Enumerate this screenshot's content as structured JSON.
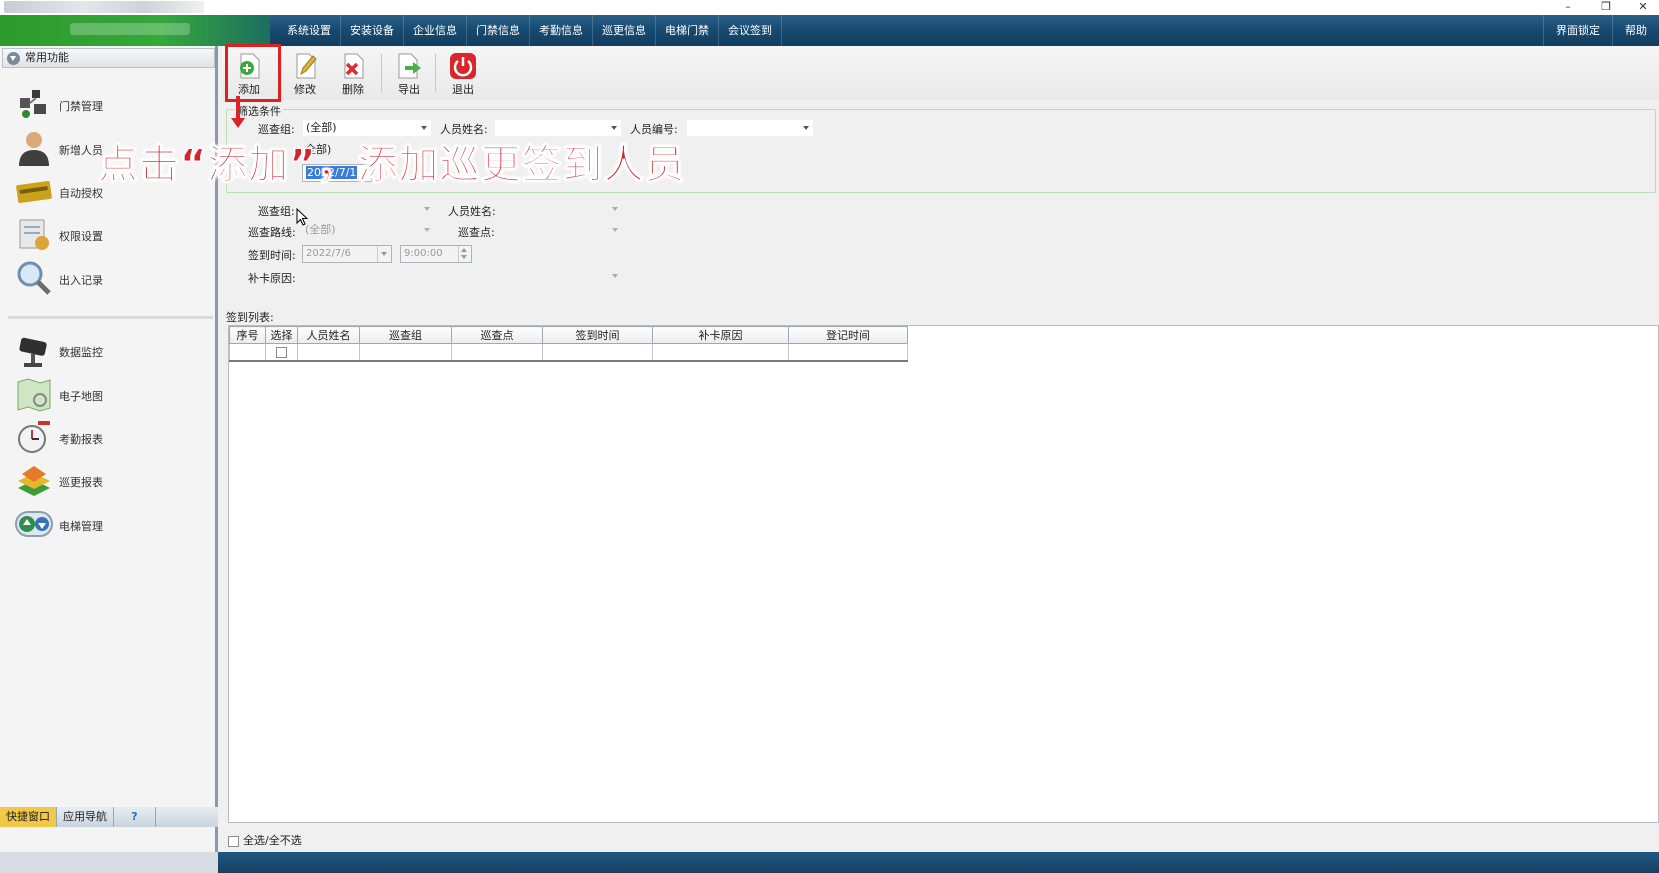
{
  "menu": {
    "items": [
      "系统设置",
      "安装设备",
      "企业信息",
      "门禁信息",
      "考勤信息",
      "巡更信息",
      "电梯门禁",
      "会议签到"
    ],
    "right_items": [
      "界面锁定",
      "帮助"
    ]
  },
  "sidebar": {
    "header": "常用功能",
    "items": [
      {
        "label": "门禁管理",
        "icon": "door-control-icon"
      },
      {
        "label": "新增人员",
        "icon": "person-icon"
      },
      {
        "label": "自动授权",
        "icon": "card-icon"
      },
      {
        "label": "权限设置",
        "icon": "permission-icon"
      },
      {
        "label": "出入记录",
        "icon": "magnifier-icon"
      },
      {
        "label": "数据监控",
        "icon": "camera-icon"
      },
      {
        "label": "电子地图",
        "icon": "map-icon"
      },
      {
        "label": "考勤报表",
        "icon": "clock-icon"
      },
      {
        "label": "巡更报表",
        "icon": "patrol-icon"
      },
      {
        "label": "电梯管理",
        "icon": "elevator-icon"
      }
    ],
    "bottom_tabs": [
      "快捷窗口",
      "应用导航",
      "?"
    ]
  },
  "toolbar": {
    "add": "添加",
    "edit": "修改",
    "delete": "删除",
    "export": "导出",
    "exit": "退出"
  },
  "filter": {
    "legend": "筛选条件",
    "group_label": "巡查组:",
    "group_value": "(全部)",
    "name_label": "人员姓名:",
    "name_value": "",
    "id_label": "人员编号:",
    "id_value": "",
    "row2_value": "全部)",
    "date_value": "2022/7/1"
  },
  "annotation": "点击“添加”，添加巡更签到人员",
  "form": {
    "group_label": "巡查组:",
    "group_value": "",
    "name_label": "人员姓名:",
    "name_value": "",
    "route_label": "巡查路线:",
    "route_value": "(全部)",
    "point_label": "巡查点:",
    "point_value": "",
    "time_label": "签到时间:",
    "date_value": "2022/7/6",
    "time_value": "9:00:00",
    "reason_label": "补卡原因:",
    "reason_value": ""
  },
  "list": {
    "title": "签到列表:",
    "columns": [
      "序号",
      "选择",
      "人员姓名",
      "巡查组",
      "巡查点",
      "签到时间",
      "补卡原因",
      "登记时间"
    ]
  },
  "footer": {
    "select_all": "全选/全不选"
  },
  "colors": {
    "menu_bar": "#174a70",
    "highlight": "#e02020",
    "annotation": "#d8232a"
  }
}
